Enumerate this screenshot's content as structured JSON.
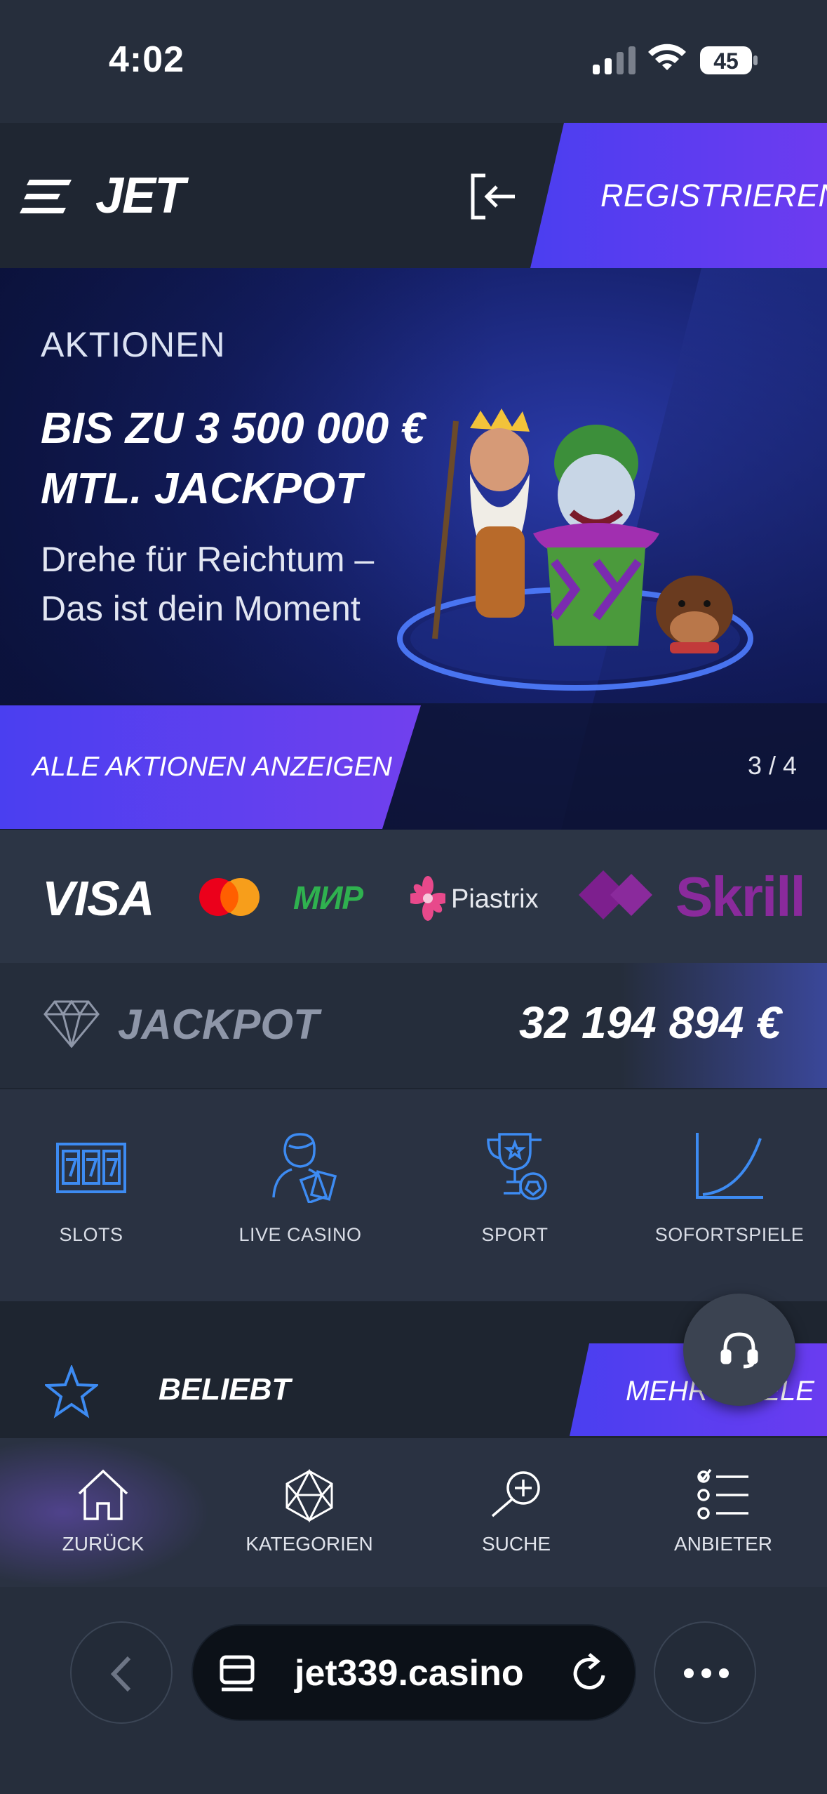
{
  "status_bar": {
    "time": "4:02",
    "battery": "45"
  },
  "header": {
    "logo": "JET",
    "register_label": "REGISTRIEREN"
  },
  "banner": {
    "kicker": "AKTIONEN",
    "title_line1": "BIS ZU 3 500 000 €",
    "title_line2": "MTL. JACKPOT",
    "subtitle_line1": "Drehe für Reichtum –",
    "subtitle_line2": "Das ist dein Moment",
    "cta_label": "ALLE AKTIONEN ANZEIGEN",
    "pager": "3 / 4"
  },
  "payments": {
    "visa": "VISA",
    "mir": "МИР",
    "piastrix": "Piastrix",
    "skrill": "Skrill"
  },
  "jackpot": {
    "label": "JACKPOT",
    "value": "32 194 894 €"
  },
  "categories": [
    {
      "label": "SLOTS",
      "icon": "slots-777-icon"
    },
    {
      "label": "LIVE CASINO",
      "icon": "live-dealer-icon"
    },
    {
      "label": "SPORT",
      "icon": "trophy-ball-icon"
    },
    {
      "label": "SOFORTSPIELE",
      "icon": "crash-curve-icon"
    }
  ],
  "popular": {
    "label": "BELIEBT",
    "more_label": "MEHR SPIELE"
  },
  "bottom_nav": [
    {
      "label": "ZURÜCK",
      "icon": "home-icon"
    },
    {
      "label": "KATEGORIEN",
      "icon": "dice-icon"
    },
    {
      "label": "SUCHE",
      "icon": "search-plus-icon"
    },
    {
      "label": "ANBIETER",
      "icon": "list-check-icon"
    }
  ],
  "browser": {
    "url": "jet339.casino"
  },
  "colors": {
    "accent_start": "#4b3ef0",
    "accent_end": "#6d3bf0",
    "icon_blue": "#3d8bf2",
    "bg": "#252d3b"
  }
}
